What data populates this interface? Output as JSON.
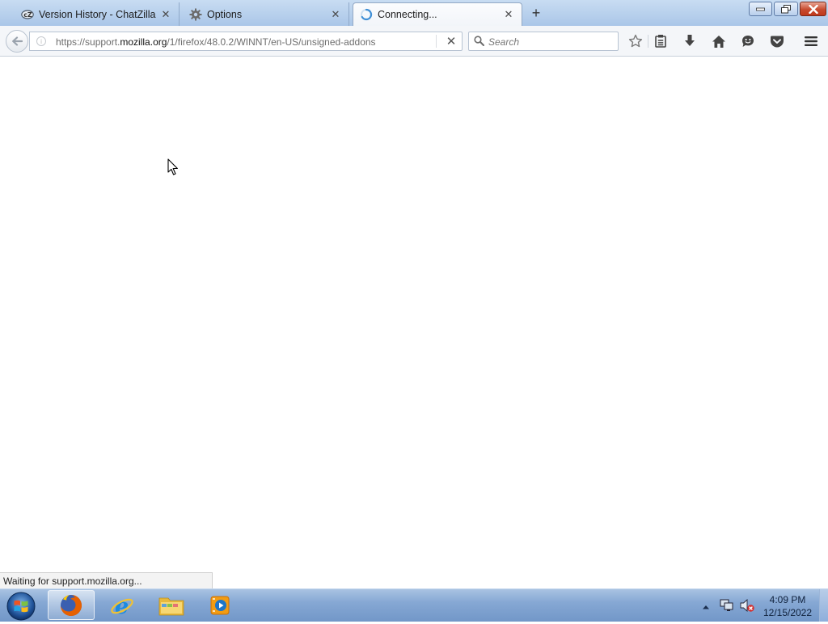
{
  "tabs": [
    {
      "label": "Version History - ChatZilla",
      "icon": "chatzilla-icon",
      "active": false
    },
    {
      "label": "Options",
      "icon": "gear-icon",
      "active": false
    },
    {
      "label": "Connecting...",
      "icon": "loading-spinner-icon",
      "active": true
    }
  ],
  "tab_close_glyph": "✕",
  "new_tab_glyph": "+",
  "navbar": {
    "url_prefix": "https://support.",
    "url_host": "mozilla.org",
    "url_path": "/1/firefox/48.0.2/WINNT/en-US/unsigned-addons",
    "stop_glyph": "✕",
    "search_placeholder": "Search",
    "toolbar_icons": [
      "bookmark-star-icon",
      "reading-list-icon",
      "downloads-icon",
      "home-icon",
      "hello-icon",
      "pocket-icon",
      "hamburger-menu-icon"
    ]
  },
  "status_text": "Waiting for support.mozilla.org...",
  "taskbar": {
    "pinned": [
      "firefox-icon",
      "internet-explorer-icon",
      "file-explorer-icon",
      "media-player-icon"
    ],
    "clock_time": "4:09 PM",
    "clock_date": "12/15/2022"
  },
  "colors": {
    "tab_strip": "#b6cfec",
    "taskbar": "#86a8d4",
    "spinner": "#3f8fd6"
  }
}
